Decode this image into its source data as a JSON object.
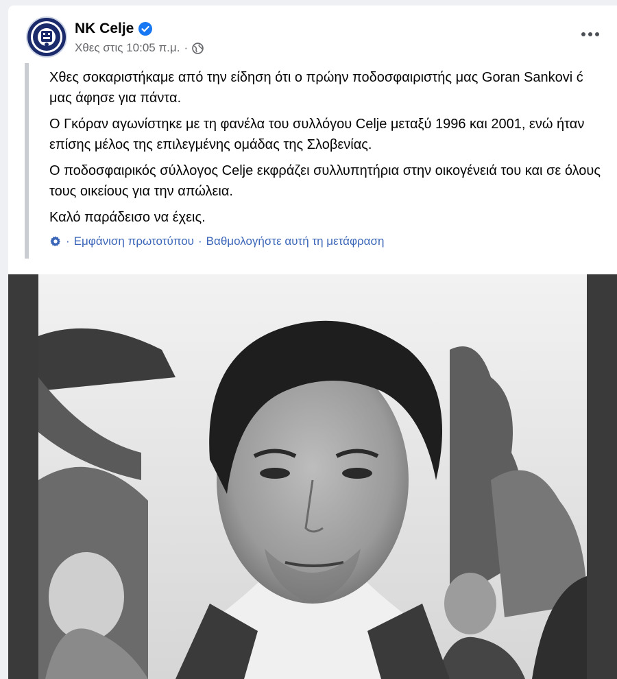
{
  "post": {
    "page_name": "NK Celje",
    "timestamp": "Χθες στις 10:05 π.μ.",
    "separator": "·",
    "paragraphs": [
      "Χθες σοκαριστήκαμε από την είδηση ότι ο πρώην ποδοσφαιριστής μας Goran Sankovi ć μας άφησε για πάντα.",
      "Ο Γκόραν αγωνίστηκε με τη φανέλα του συλλόγου Celje μεταξύ 1996 και 2001, ενώ ήταν επίσης μέλος της επιλεγμένης ομάδας της Σλοβενίας.",
      "Ο ποδοσφαιρικός σύλλογος Celje εκφράζει συλλυπητήρια στην οικογένειά του και σε όλους τους οικείους για την απώλεια.",
      "Καλό παράδεισο να έχεις."
    ],
    "translation": {
      "sep": "·",
      "show_original": "Εμφάνιση πρωτοτύπου",
      "rate": "Βαθμολογήστε αυτή τη μετάφραση"
    }
  },
  "colors": {
    "link": "#3b66b8",
    "verified": "#1877f2",
    "meta": "#65676b"
  },
  "icons": {
    "verified": "verified-badge-icon",
    "privacy": "globe-icon",
    "more": "more-options-icon",
    "translate": "gear-icon"
  }
}
